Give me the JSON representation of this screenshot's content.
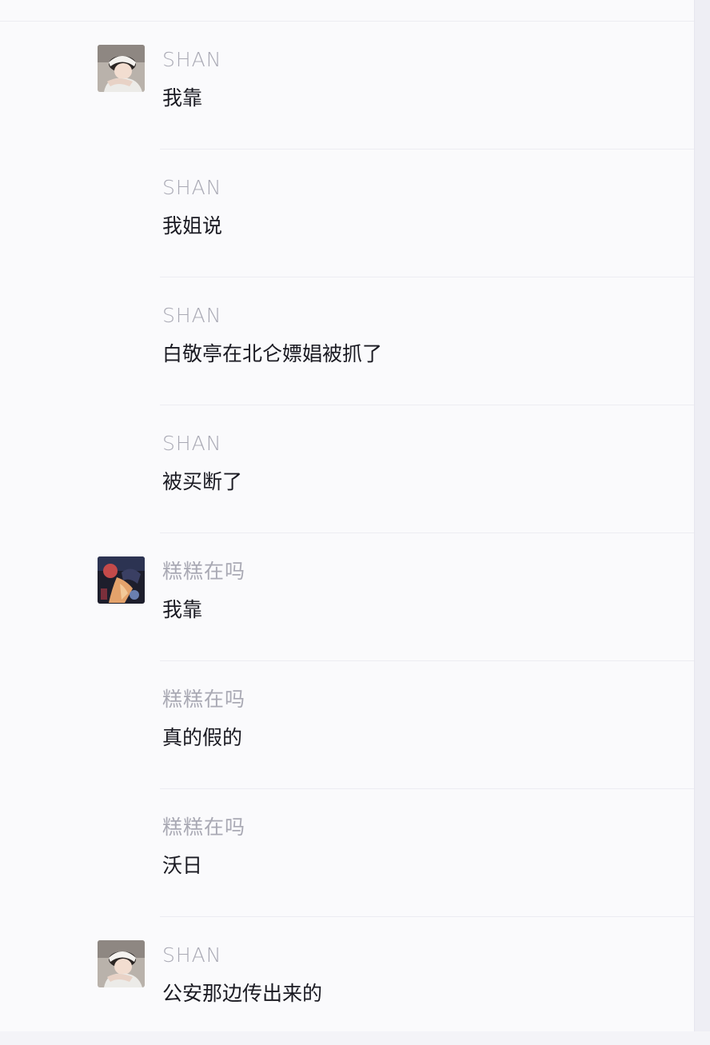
{
  "chat": {
    "messages": [
      {
        "sender": "SHAN",
        "text": "我靠",
        "avatar": "shan-avatar",
        "show_avatar": true
      },
      {
        "sender": "SHAN",
        "text": "我姐说",
        "avatar": "shan-avatar",
        "show_avatar": false
      },
      {
        "sender": "SHAN",
        "text": "白敬亭在北仑嫖娼被抓了",
        "avatar": "shan-avatar",
        "show_avatar": false
      },
      {
        "sender": "SHAN",
        "text": "被买断了",
        "avatar": "shan-avatar",
        "show_avatar": false
      },
      {
        "sender": "糕糕在吗",
        "text": "我靠",
        "avatar": "gaogao-avatar",
        "show_avatar": true
      },
      {
        "sender": "糕糕在吗",
        "text": "真的假的",
        "avatar": "gaogao-avatar",
        "show_avatar": false
      },
      {
        "sender": "糕糕在吗",
        "text": "沃日",
        "avatar": "gaogao-avatar",
        "show_avatar": false
      },
      {
        "sender": "SHAN",
        "text": "公安那边传出来的",
        "avatar": "shan-avatar",
        "show_avatar": true
      }
    ]
  },
  "colors": {
    "panel_background": "#fafafc",
    "sender_name": "#a9a9b4",
    "message_text": "#1a1a22",
    "divider": "#ececf2"
  }
}
